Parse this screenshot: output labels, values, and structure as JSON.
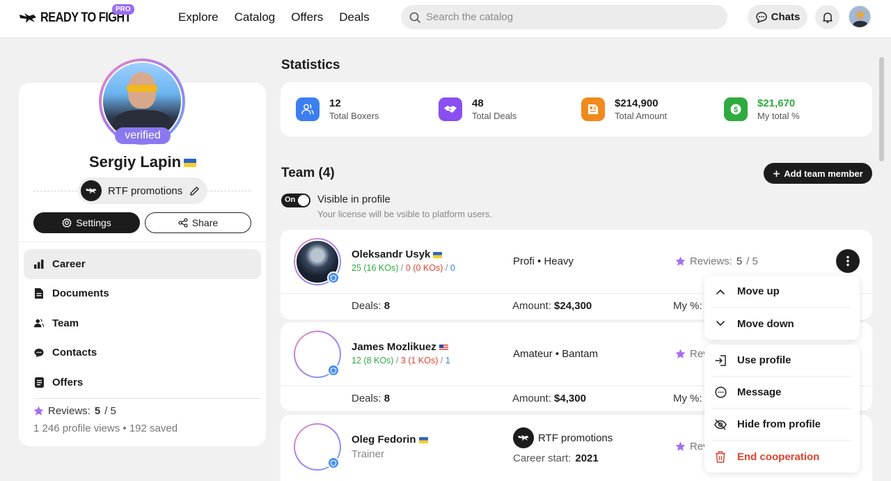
{
  "header": {
    "brand": "READY TO FIGHT",
    "pro_badge": "PRO",
    "nav": [
      "Explore",
      "Catalog",
      "Offers",
      "Deals"
    ],
    "search_placeholder": "Search the catalog",
    "chats_label": "Chats"
  },
  "profile": {
    "verified_label": "verified",
    "name": "Sergiy Lapin",
    "org_name": "RTF promotions",
    "settings_label": "Settings",
    "share_label": "Share",
    "menu": [
      {
        "label": "Career",
        "icon": "bar-chart-icon",
        "active": true
      },
      {
        "label": "Documents",
        "icon": "document-icon",
        "active": false
      },
      {
        "label": "Team",
        "icon": "team-icon",
        "active": false
      },
      {
        "label": "Contacts",
        "icon": "chat-bubble-icon",
        "active": false
      },
      {
        "label": "Offers",
        "icon": "offers-icon",
        "active": false
      }
    ],
    "reviews_label": "Reviews:",
    "reviews_value": "5",
    "reviews_max": "/ 5",
    "views": "1 246 profile views",
    "saved": "192 saved"
  },
  "statistics": {
    "title": "Statistics",
    "items": [
      {
        "value": "12",
        "label": "Total Boxers",
        "icon": "boxers-icon",
        "color": "#3b7ff0"
      },
      {
        "value": "48",
        "label": "Total Deals",
        "icon": "handshake-icon",
        "color": "#8a4ff0"
      },
      {
        "value": "$214,900",
        "label": "Total Amount",
        "icon": "invoice-icon",
        "color": "#f08a1c"
      },
      {
        "value": "$21,670",
        "label": "My total %",
        "icon": "dollar-icon",
        "color": "#2eaa3f"
      }
    ]
  },
  "team": {
    "title": "Team (4)",
    "add_label": "Add team member",
    "toggle_label": "On",
    "visible_title": "Visible in profile",
    "visible_sub": "Your license will be vsible to platform users.",
    "members": [
      {
        "name": "Oleksandr Usyk",
        "wins": "25",
        "wins_kos": "(16 KOs)",
        "losses": "0",
        "losses_kos": "(0 KOs)",
        "draws": "0",
        "level": "Profi",
        "weight": "Heavy",
        "reviews_label": "Reviews:",
        "reviews_value": "5",
        "reviews_max": "/ 5",
        "deals_label": "Deals:",
        "deals": "8",
        "amount_label": "Amount:",
        "amount": "$24,300",
        "my_label": "My %:"
      },
      {
        "name": "James Mozlikuez",
        "wins": "12",
        "wins_kos": "(8 KOs)",
        "losses": "3",
        "losses_kos": "(1 KOs)",
        "draws": "1",
        "level": "Amateur",
        "weight": "Bantam",
        "reviews_label": "Rev",
        "deals_label": "Deals:",
        "deals": "8",
        "amount_label": "Amount:",
        "amount": "$4,300",
        "my_label": "My %:"
      },
      {
        "name": "Oleg Fedorin",
        "role": "Trainer",
        "org_name": "RTF promotions",
        "career_label": "Career start:",
        "career_year": "2021",
        "reviews_label": "Rev"
      }
    ]
  },
  "menu_upper": [
    {
      "label": "Move up",
      "icon": "chevron-up-icon"
    },
    {
      "label": "Move down",
      "icon": "chevron-down-icon"
    }
  ],
  "menu_lower": [
    {
      "label": "Use profile",
      "icon": "login-icon"
    },
    {
      "label": "Message",
      "icon": "message-icon"
    },
    {
      "label": "Hide from profile",
      "icon": "eye-off-icon"
    },
    {
      "label": "End cooperation",
      "icon": "trash-icon",
      "danger": true
    }
  ]
}
